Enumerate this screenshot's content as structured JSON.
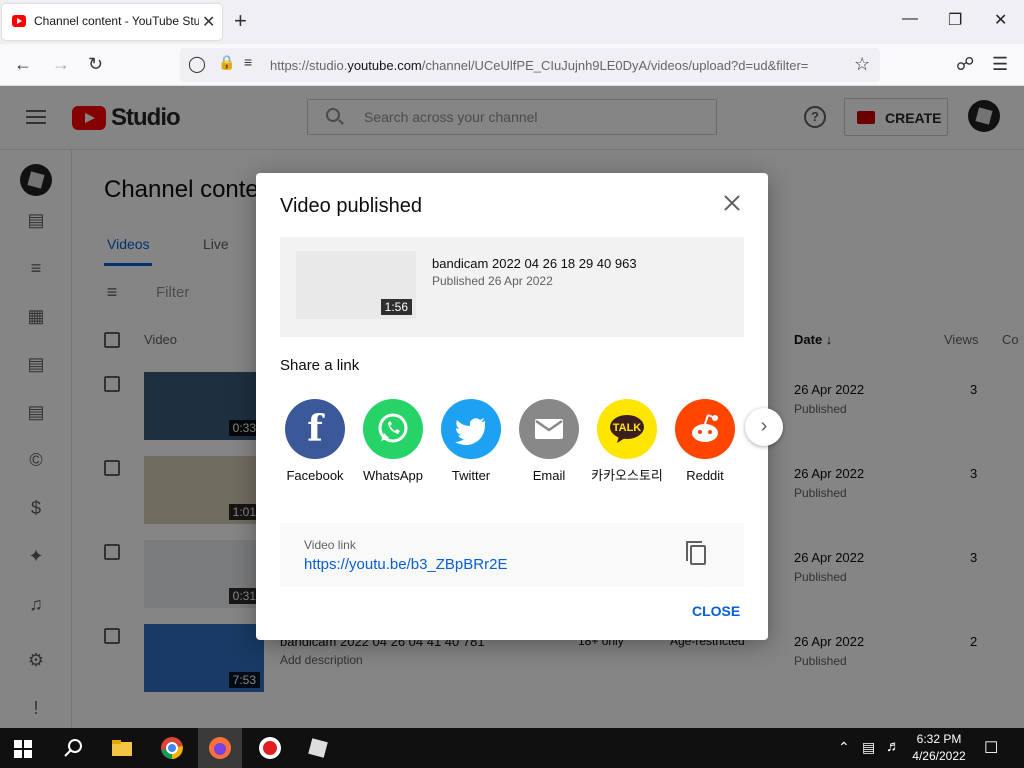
{
  "browser": {
    "tab_title": "Channel content - YouTube Studio",
    "url_prefix": "https://studio.",
    "url_domain": "youtube.com",
    "url_suffix": "/channel/UCeUlfPE_CIuJujnh9LE0DyA/videos/upload?d=ud&filter=",
    "tab_close": "✕",
    "new_tab": "+",
    "minimize": "—",
    "maximize": "❐",
    "close": "✕"
  },
  "header": {
    "logo_text": "Studio",
    "search_placeholder": "Search across your channel",
    "help": "?",
    "create_label": "CREATE"
  },
  "content": {
    "title": "Channel conte",
    "tabs": [
      "Videos",
      "Live"
    ],
    "filter_placeholder": "Filter",
    "columns": {
      "video": "Video",
      "date": "Date",
      "views": "Views",
      "comments": "Co"
    },
    "rows": [
      {
        "duration": "0:33",
        "date": "26 Apr 2022",
        "status": "Published",
        "views": "3"
      },
      {
        "duration": "1:01",
        "date": "26 Apr 2022",
        "status": "Published",
        "views": "3"
      },
      {
        "duration": "0:31",
        "date": "26 Apr 2022",
        "status": "Published",
        "views": "3"
      },
      {
        "duration": "7:53",
        "title": "bandicam 2022 04 26 04 41 40 781",
        "desc": "Add description",
        "restriction": "18+ only",
        "restriction2": "Age-restricted",
        "date": "26 Apr 2022",
        "status": "Published",
        "views": "2"
      }
    ]
  },
  "dialog": {
    "title": "Video published",
    "video_title": "bandicam 2022 04 26 18 29 40 963",
    "video_date": "Published 26 Apr 2022",
    "video_duration": "1:56",
    "share_heading": "Share a link",
    "share_targets": [
      {
        "label": "Facebook",
        "color": "#3b5998",
        "icon": "f"
      },
      {
        "label": "WhatsApp",
        "color": "#25d366",
        "icon": "whatsapp"
      },
      {
        "label": "Twitter",
        "color": "#1da1f2",
        "icon": "twitter"
      },
      {
        "label": "Email",
        "color": "#888888",
        "icon": "envelope"
      },
      {
        "label": "카카오스토리",
        "color": "#fee500",
        "icon": "TALK"
      },
      {
        "label": "Reddit",
        "color": "#ff4500",
        "icon": "reddit"
      }
    ],
    "link_label": "Video link",
    "link_url": "https://youtu.be/b3_ZBpBRr2E",
    "close_label": "CLOSE"
  },
  "taskbar": {
    "time": "6:32 PM",
    "date": "4/26/2022"
  }
}
